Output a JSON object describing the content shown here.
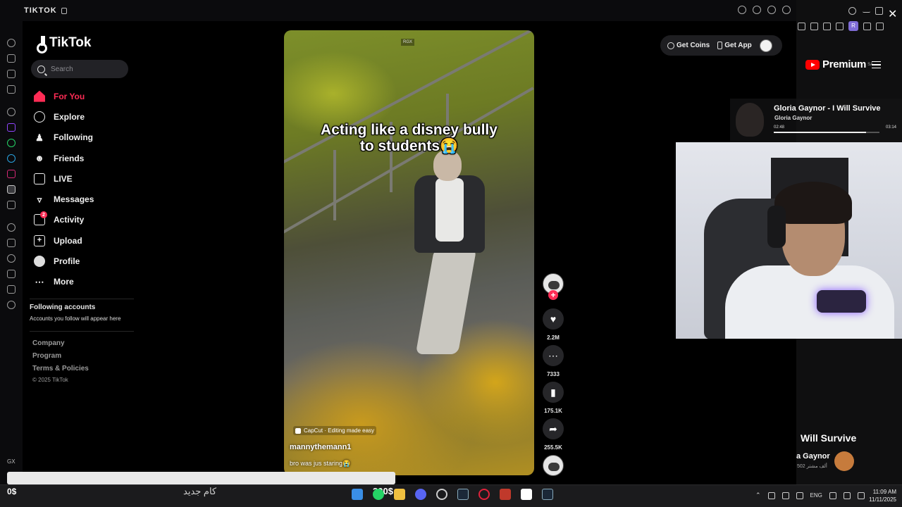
{
  "browser": {
    "title": "TIKTOK"
  },
  "sidebar_gx": {
    "label": "GX"
  },
  "tiktok": {
    "logo": "TikTok",
    "search_placeholder": "Search",
    "nav": [
      {
        "label": "For You",
        "icon": "home-icon",
        "active": true
      },
      {
        "label": "Explore",
        "icon": "compass-icon"
      },
      {
        "label": "Following",
        "icon": "following-icon"
      },
      {
        "label": "Friends",
        "icon": "friends-icon"
      },
      {
        "label": "LIVE",
        "icon": "live-icon"
      },
      {
        "label": "Messages",
        "icon": "messages-icon"
      },
      {
        "label": "Activity",
        "icon": "activity-icon",
        "badge": "2"
      },
      {
        "label": "Upload",
        "icon": "upload-icon"
      },
      {
        "label": "Profile",
        "icon": "profile-avatar-icon"
      },
      {
        "label": "More",
        "icon": "more-icon"
      }
    ],
    "following_accounts_heading": "Following accounts",
    "following_accounts_sub": "Accounts you follow will appear here",
    "footer": [
      "Company",
      "Program",
      "Terms & Policies"
    ],
    "copyright": "© 2025 TikTok",
    "top_actions": {
      "coins": "Get Coins",
      "app": "Get App"
    }
  },
  "video": {
    "caption_line1": "Acting like a disney bully",
    "caption_line2": "to students😭",
    "watermark": "RGX",
    "capcut": "CapCut · Editing made easy",
    "author": "mannythemann1",
    "description": "bro was jus staring😭",
    "likes": "2.2M",
    "comments": "7333",
    "bookmarks": "175.1K",
    "shares": "255.5K"
  },
  "youtube": {
    "brand": "Premium",
    "region": "SA",
    "now_playing_title": "Gloria Gaynor - I Will Survive",
    "now_playing_artist": "Gloria Gaynor",
    "elapsed": "02:48",
    "duration": "03:14",
    "progress": 0.87,
    "song_title": "Will Survive",
    "channel": "a Gaynor",
    "subscribers": "502 ألف مشتر"
  },
  "overlay": {
    "money": "0$",
    "goal_label": "كام جديد",
    "goal_amount": "300$"
  },
  "taskbar": {
    "lang": "ENG",
    "time": "11:09 AM",
    "date": "11/11/2025"
  },
  "colors": {
    "accent": "#fe2c55",
    "youtube_red": "#ff0000"
  }
}
